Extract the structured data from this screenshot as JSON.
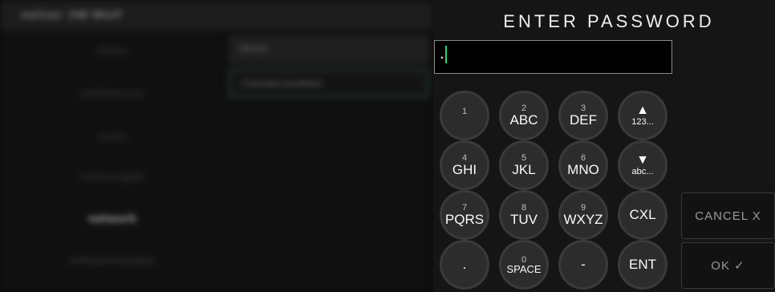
{
  "background": {
    "logo_text": "netzer 3W-Wolf",
    "nav_items": [
      "status",
      "preferences",
      "audio",
      "midi/cv/gate",
      "network",
      "software/update"
    ],
    "active_nav": "network",
    "rows": [
      "Server",
      "Client/AccessPoint"
    ]
  },
  "dialog": {
    "title": "ENTER PASSWORD",
    "password_value": ".",
    "keys": [
      {
        "num": "1",
        "letters": ""
      },
      {
        "num": "2",
        "letters": "ABC"
      },
      {
        "num": "3",
        "letters": "DEF"
      },
      {
        "num": "",
        "letters": "123...",
        "icon": "▲"
      },
      {
        "num": "4",
        "letters": "GHI"
      },
      {
        "num": "5",
        "letters": "JKL"
      },
      {
        "num": "6",
        "letters": "MNO"
      },
      {
        "num": "",
        "letters": "abc...",
        "icon": "▼"
      },
      {
        "num": "7",
        "letters": "PQRS"
      },
      {
        "num": "8",
        "letters": "TUV"
      },
      {
        "num": "9",
        "letters": "WXYZ"
      },
      {
        "num": "",
        "letters": "CXL"
      },
      {
        "num": ".",
        "letters": ""
      },
      {
        "num": "0",
        "letters": "SPACE"
      },
      {
        "num": "-",
        "letters": ""
      },
      {
        "num": "",
        "letters": "ENT"
      }
    ],
    "cancel_label": "CANCEL X",
    "ok_label": "OK ✓"
  },
  "colors": {
    "cursor": "#2fd37a",
    "selected_row_border": "#274a39"
  }
}
